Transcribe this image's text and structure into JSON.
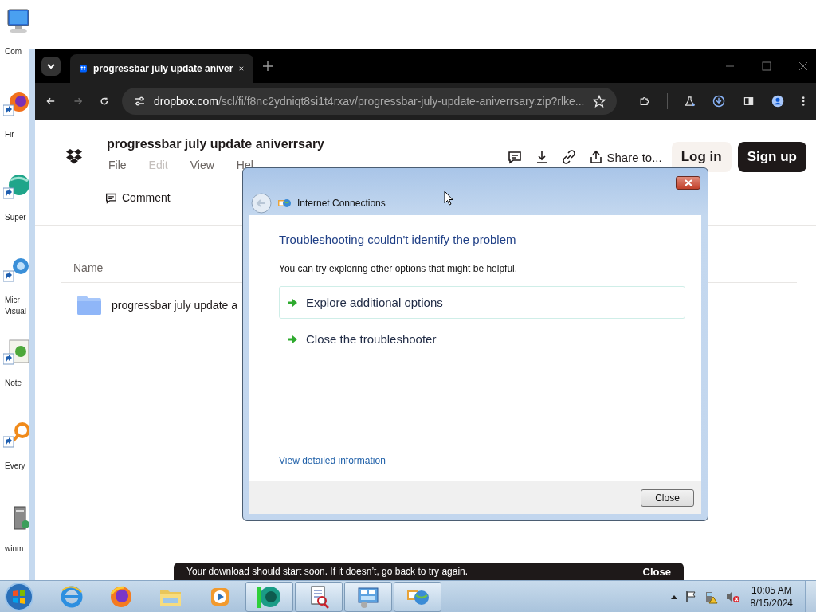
{
  "desktop_icons": [
    {
      "kind": "computer",
      "label": "Com"
    },
    {
      "kind": "fox",
      "label": "Fir"
    },
    {
      "kind": "sphere",
      "label": "Super"
    },
    {
      "kind": "studio",
      "label": "Micr Visual"
    },
    {
      "kind": "frog",
      "label": "Note"
    },
    {
      "kind": "magnifier",
      "label": "Every"
    },
    {
      "kind": "tower",
      "label": "winm"
    }
  ],
  "browser": {
    "tabs": [
      {
        "title": "progressbar july update aniver",
        "selected": true
      }
    ],
    "forward_disabled": true,
    "url_domain": "dropbox.com",
    "url_path": "/scl/fi/f8nc2ydniqt8si1t4rxav/progressbar-july-update-aniverrsary.zip?rlke...",
    "page": {
      "title": "progressbar july update aniverrsary",
      "menu": [
        {
          "label": "File",
          "disabled": false
        },
        {
          "label": "Edit",
          "disabled": true
        },
        {
          "label": "View",
          "disabled": false
        },
        {
          "label": "Hel",
          "disabled": false
        }
      ],
      "share": "Share to...",
      "login": "Log in",
      "signup": "Sign up",
      "comment": "Comment",
      "table": {
        "columns": [
          "Name"
        ],
        "rows": [
          {
            "name": "progressbar july update a"
          }
        ]
      },
      "toast": {
        "message": "Your download should start soon. If it doesn’t, go back to try again.",
        "action": "Close"
      }
    }
  },
  "dialog": {
    "title": "Internet Connections",
    "heading": "Troubleshooting couldn't identify the problem",
    "message": "You can try exploring other options that might be helpful.",
    "options": [
      {
        "label": "Explore additional options",
        "selected": true
      },
      {
        "label": "Close the troubleshooter",
        "selected": false
      }
    ],
    "link": "View detailed information",
    "button": "Close"
  },
  "taskbar": {
    "items": [
      {
        "kind": "ie",
        "active": false
      },
      {
        "kind": "firefox",
        "active": false
      },
      {
        "kind": "folder",
        "active": false
      },
      {
        "kind": "media",
        "active": false
      },
      {
        "kind": "sphere",
        "active": true
      },
      {
        "kind": "doc",
        "active": true
      },
      {
        "kind": "panel",
        "active": true
      },
      {
        "kind": "network",
        "active": true
      }
    ],
    "time": "10:05 AM",
    "date": "8/15/2024"
  }
}
